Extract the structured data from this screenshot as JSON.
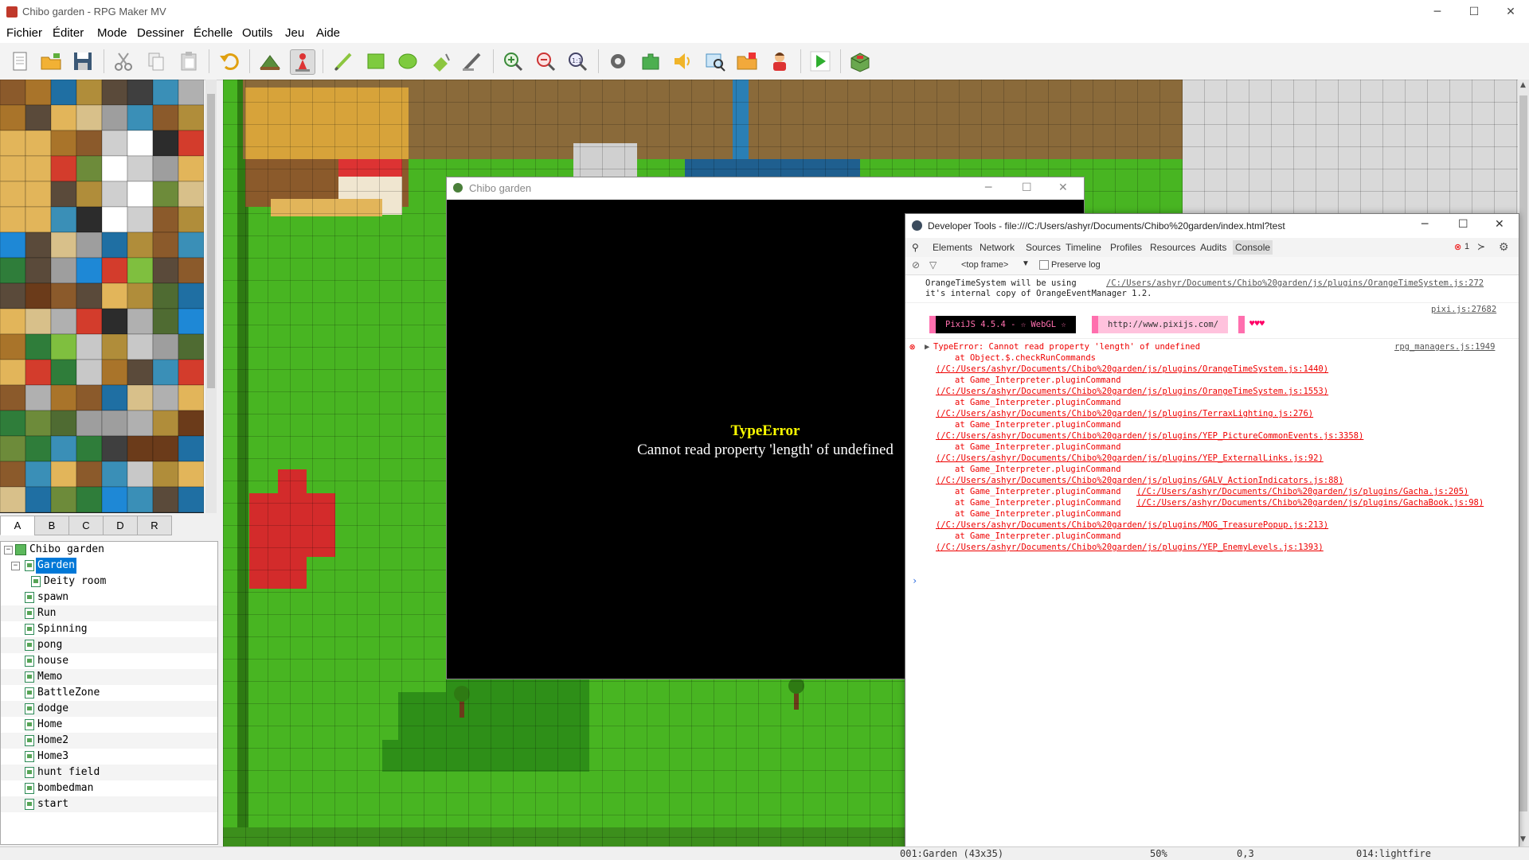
{
  "window": {
    "title": "Chibo garden - RPG Maker MV",
    "minimize": "─",
    "maximize": "☐",
    "close": "✕"
  },
  "menu": [
    "Fichier",
    "Éditer",
    "Mode",
    "Dessiner",
    "Échelle",
    "Outils",
    "Jeu",
    "Aide"
  ],
  "toolbar_icons": [
    "new-project-icon",
    "open-project-icon",
    "save-project-icon",
    "cut-icon",
    "copy-icon",
    "paste-icon",
    "undo-icon",
    "map-mode-icon",
    "event-mode-icon",
    "pencil-icon",
    "rectangle-icon",
    "ellipse-icon",
    "fill-icon",
    "shadow-pen-icon",
    "zoom-in-icon",
    "zoom-out-icon",
    "actual-size-icon",
    "database-icon",
    "plugin-manager-icon",
    "sound-test-icon",
    "event-searcher-icon",
    "resource-manager-icon",
    "character-generator-icon",
    "playtest-icon",
    "game-folder-icon"
  ],
  "tileset_tabs": [
    "A",
    "B",
    "C",
    "D",
    "R"
  ],
  "map_tree": {
    "root": "Chibo garden",
    "selected": "Garden",
    "children_of_selected": [
      "Deity room"
    ],
    "maps": [
      "spawn",
      "Run",
      "Spinning",
      "pong",
      "house",
      "Memo",
      "BattleZone",
      "dodge",
      "Home",
      "Home2",
      "Home3",
      "hunt field",
      "bombedman",
      "start"
    ]
  },
  "game_window": {
    "title": "Chibo garden",
    "error_title": "TypeError",
    "error_message": "Cannot read property 'length' of undefined"
  },
  "devtools": {
    "title": "Developer Tools - file:///C:/Users/ashyr/Documents/Chibo%20garden/index.html?test",
    "tabs": [
      "Elements",
      "Network",
      "Sources",
      "Timeline",
      "Profiles",
      "Resources",
      "Audits",
      "Console"
    ],
    "active_tab": "Console",
    "error_count": "1",
    "frame": "<top frame>",
    "preserve_log": "Preserve log",
    "log1_line1": "OrangeTimeSystem will be using",
    "log1_link": "/C:/Users/ashyr/Documents/Chibo%20garden/js/plugins/OrangeTimeSystem.js:272",
    "log1_line2": "it's internal copy of OrangeEventManager 1.2.",
    "pixi_src": "pixi.js:27682",
    "pixi_version": "PixiJS 4.5.4 - ☆ WebGL ☆",
    "pixi_url": "http://www.pixijs.com/",
    "pixi_hearts": "♥♥♥",
    "error_src": "rpg_managers.js:1949",
    "error_head": "TypeError: Cannot read property 'length' of undefined",
    "stack": [
      {
        "text": "at Object.$.checkRunCommands",
        "link": ""
      },
      {
        "text": "",
        "link": "(/C:/Users/ashyr/Documents/Chibo%20garden/js/plugins/OrangeTimeSystem.js:1440)"
      },
      {
        "text": "at Game_Interpreter.pluginCommand",
        "link": ""
      },
      {
        "text": "",
        "link": "(/C:/Users/ashyr/Documents/Chibo%20garden/js/plugins/OrangeTimeSystem.js:1553)"
      },
      {
        "text": "at Game_Interpreter.pluginCommand",
        "link": ""
      },
      {
        "text": "",
        "link": "(/C:/Users/ashyr/Documents/Chibo%20garden/js/plugins/TerraxLighting.js:276)"
      },
      {
        "text": "at Game_Interpreter.pluginCommand",
        "link": ""
      },
      {
        "text": "",
        "link": "(/C:/Users/ashyr/Documents/Chibo%20garden/js/plugins/YEP_PictureCommonEvents.js:3358)"
      },
      {
        "text": "at Game_Interpreter.pluginCommand",
        "link": ""
      },
      {
        "text": "",
        "link": "(/C:/Users/ashyr/Documents/Chibo%20garden/js/plugins/YEP_ExternalLinks.js:92)"
      },
      {
        "text": "at Game_Interpreter.pluginCommand",
        "link": ""
      },
      {
        "text": "",
        "link": "(/C:/Users/ashyr/Documents/Chibo%20garden/js/plugins/GALV_ActionIndicators.js:88)"
      },
      {
        "text": "at Game_Interpreter.pluginCommand",
        "link": "(/C:/Users/ashyr/Documents/Chibo%20garden/js/plugins/Gacha.js:205)"
      },
      {
        "text": "at Game_Interpreter.pluginCommand",
        "link": "(/C:/Users/ashyr/Documents/Chibo%20garden/js/plugins/GachaBook.js:98)"
      },
      {
        "text": "at Game_Interpreter.pluginCommand",
        "link": ""
      },
      {
        "text": "",
        "link": "(/C:/Users/ashyr/Documents/Chibo%20garden/js/plugins/MOG_TreasurePopup.js:213)"
      },
      {
        "text": "at Game_Interpreter.pluginCommand",
        "link": ""
      },
      {
        "text": "",
        "link": "(/C:/Users/ashyr/Documents/Chibo%20garden/js/plugins/YEP_EnemyLevels.js:1393)"
      }
    ],
    "prompt": "›"
  },
  "status_bar": {
    "map": "001:Garden (43x35)",
    "zoom": "50%",
    "coords": "0,3",
    "tile": "014:lightfire"
  },
  "colors": {
    "selection": "#0078d7",
    "error": "#e00000",
    "grass": "#3da41c",
    "pixi_pink": "#ff6fae"
  }
}
